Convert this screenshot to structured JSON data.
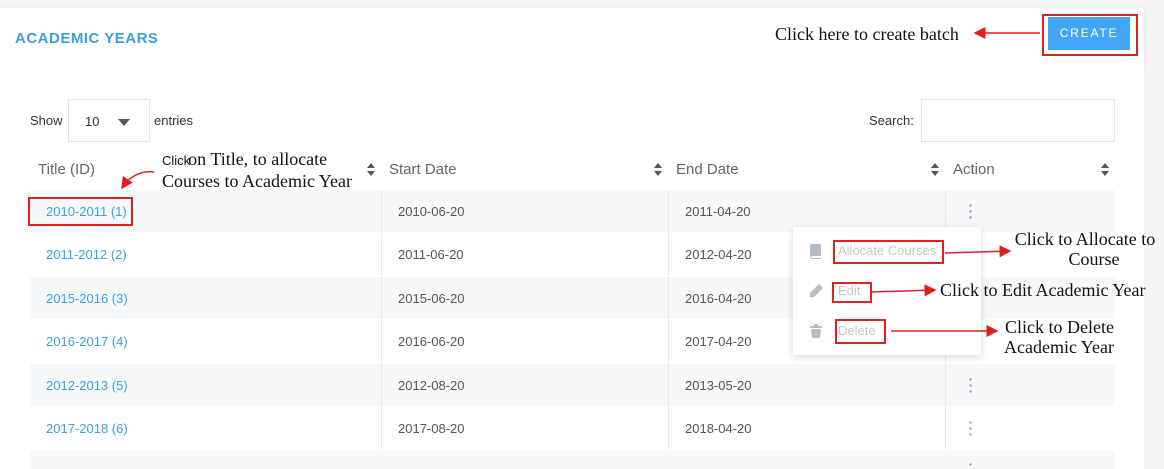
{
  "header": {
    "title": "ACADEMIC YEARS",
    "create_label": "CREATE"
  },
  "controls": {
    "show_label": "Show",
    "entries_value": "10",
    "entries_label": "entries",
    "search_label": "Search:",
    "search_value": ""
  },
  "table": {
    "columns": [
      "Title (ID)",
      "Start Date",
      "End Date",
      "Action"
    ],
    "rows": [
      {
        "title": "2010-2011 (1)",
        "start": "2010-06-20",
        "end": "2011-04-20"
      },
      {
        "title": "2011-2012 (2)",
        "start": "2011-06-20",
        "end": "2012-04-20"
      },
      {
        "title": "2015-2016 (3)",
        "start": "2015-06-20",
        "end": "2016-04-20"
      },
      {
        "title": "2016-2017 (4)",
        "start": "2016-06-20",
        "end": "2017-04-20"
      },
      {
        "title": "2012-2013 (5)",
        "start": "2012-08-20",
        "end": "2013-05-20"
      },
      {
        "title": "2017-2018 (6)",
        "start": "2017-08-20",
        "end": "2018-04-20"
      }
    ]
  },
  "action_menu": {
    "items": [
      {
        "label": "Allocate Courses",
        "icon": "book-icon"
      },
      {
        "label": "Edit",
        "icon": "pencil-icon"
      },
      {
        "label": "Delete",
        "icon": "trash-icon"
      }
    ]
  },
  "annotations": {
    "create": "Click here to create batch",
    "title_click_small": "Click",
    "title_line1": "on Title, to allocate",
    "title_line2": "Courses to Academic Year",
    "allocate_line1": "Click to Allocate to",
    "allocate_line2": "Course",
    "edit": "Click to Edit Academic Year",
    "delete_line1": "Click to Delete",
    "delete_line2": "Academic Year",
    "color": "#e01f1f"
  },
  "colors": {
    "accent": "#3a9ee4",
    "button": "#42a5f5"
  }
}
